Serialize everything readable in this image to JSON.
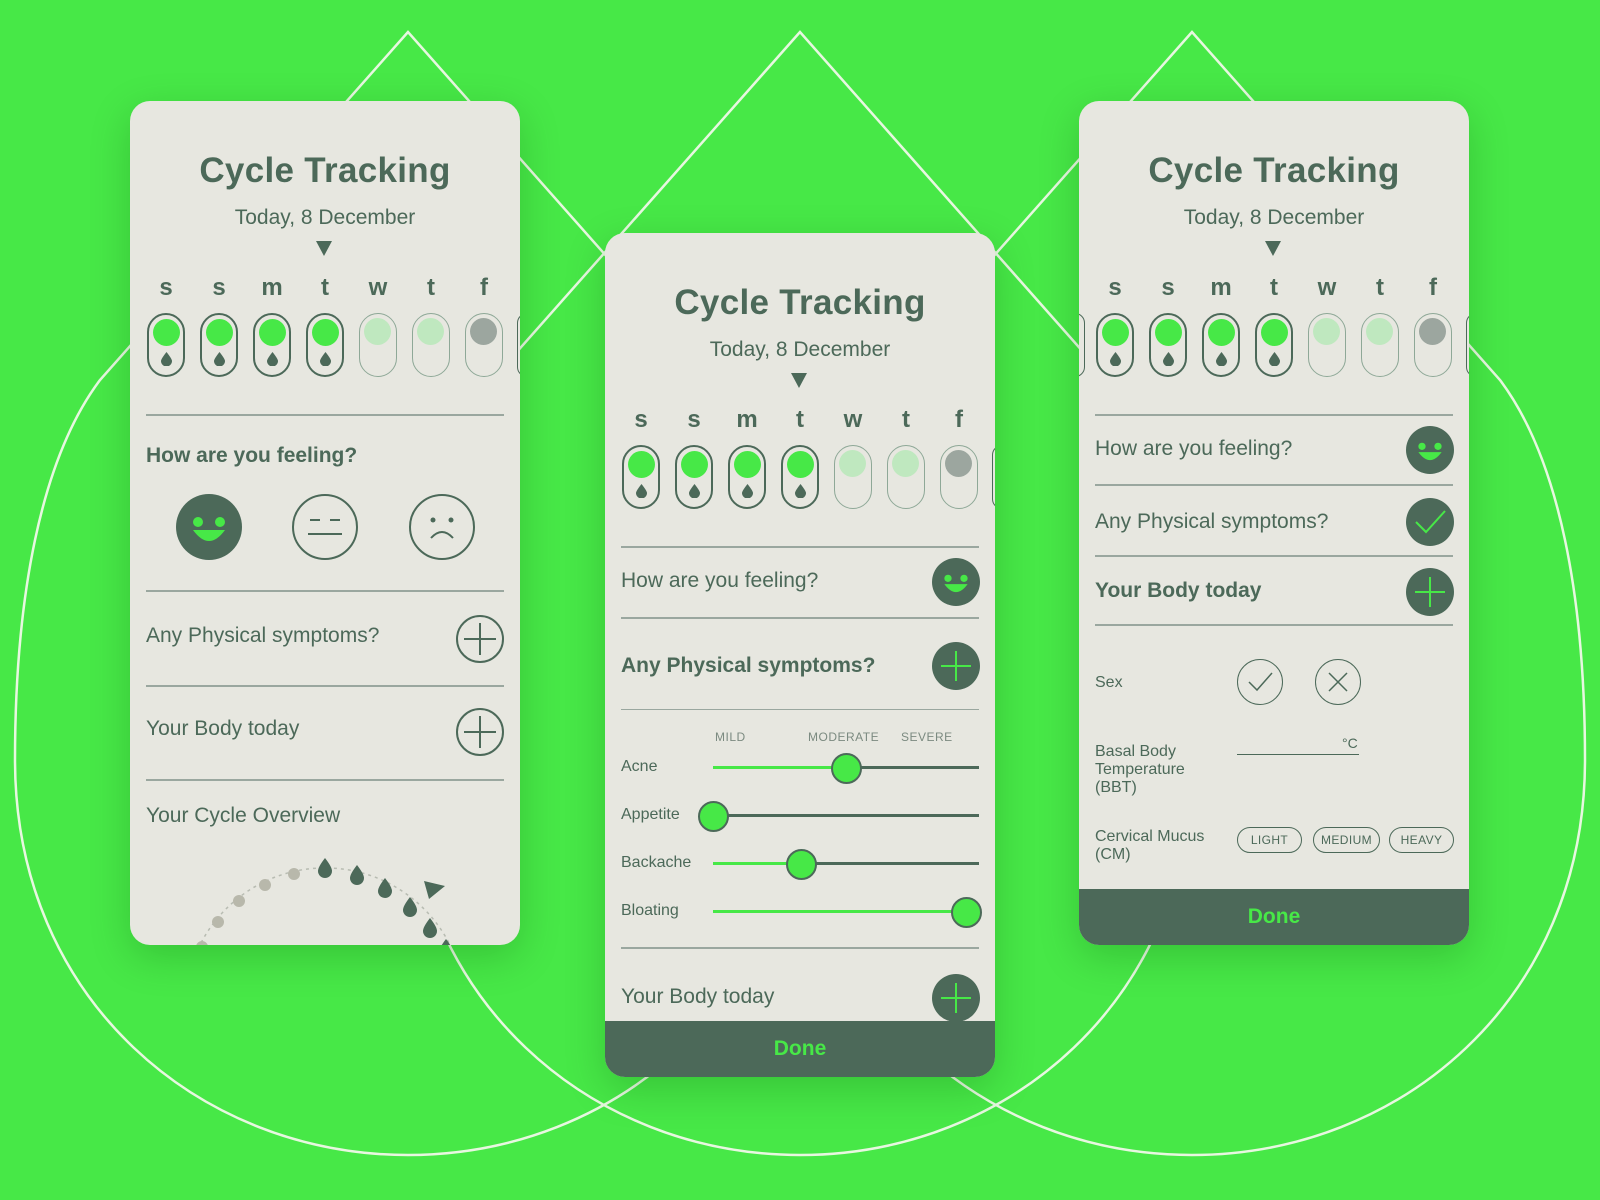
{
  "colors": {
    "background": "#47e847",
    "accent": "#47e847",
    "dark": "#4c6959",
    "card": "#e7e7e0",
    "future_dot": "#bfe8bf",
    "predicted_dot": "#9ca69f"
  },
  "week": {
    "days": [
      "s",
      "s",
      "m",
      "t",
      "w",
      "t",
      "f"
    ],
    "states": [
      "period",
      "period",
      "period",
      "period",
      "future",
      "future",
      "predicted"
    ]
  },
  "screen1": {
    "title": "Cycle Tracking",
    "date": "Today, 8 December",
    "feeling_label": "How are you feeling?",
    "moods": [
      "happy-face-icon",
      "neutral-face-icon",
      "sad-face-icon"
    ],
    "selected_mood": "happy",
    "symptoms_label": "Any Physical symptoms?",
    "body_label": "Your Body today",
    "overview_label": "Your Cycle Overview"
  },
  "screen2": {
    "title": "Cycle Tracking",
    "date": "Today, 8 December",
    "feeling_label": "How are you feeling?",
    "symptoms_label": "Any Physical symptoms?",
    "scale": [
      "MILD",
      "MODERATE",
      "SEVERE"
    ],
    "symptoms": [
      {
        "name": "Acne",
        "level": 0.5
      },
      {
        "name": "Appetite",
        "level": 0.0
      },
      {
        "name": "Backache",
        "level": 0.33
      },
      {
        "name": "Bloating",
        "level": 0.95
      }
    ],
    "body_label": "Your Body today",
    "done_label": "Done"
  },
  "screen3": {
    "title": "Cycle Tracking",
    "date": "Today, 8 December",
    "feeling_label": "How are you feeling?",
    "symptoms_label": "Any Physical symptoms?",
    "body_label": "Your Body today",
    "sex_label": "Sex",
    "bbt_label_lines": [
      "Basal Body",
      "Temperature",
      "(BBT)"
    ],
    "bbt_unit": "°C",
    "cm_label_lines": [
      "Cervical Mucus",
      "(CM)"
    ],
    "cm_options": [
      "LIGHT",
      "MEDIUM",
      "HEAVY"
    ],
    "done_label": "Done"
  }
}
